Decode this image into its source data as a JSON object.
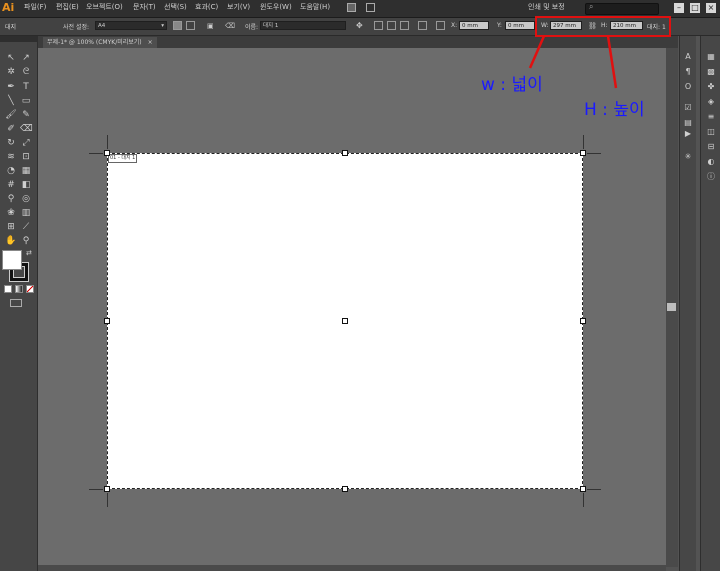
{
  "app": {
    "logo": "Ai"
  },
  "menu": [
    "파일(F)",
    "편집(E)",
    "오브젝트(O)",
    "문자(T)",
    "선택(S)",
    "효과(C)",
    "보기(V)",
    "윈도우(W)",
    "도움말(H)"
  ],
  "workspace": "인쇄 및 보정",
  "search_placeholder": "",
  "control": {
    "artboard_label": "대지",
    "preset_label": "사전 설정:",
    "preset_value": "A4",
    "name_label": "이름:",
    "name_value": "대지 1",
    "x_label": "X:",
    "x_value": "0 mm",
    "y_label": "Y:",
    "y_value": "0 mm",
    "w_label": "W:",
    "w_value": "297 mm",
    "h_label": "H:",
    "h_value": "210 mm",
    "artboard_count_label": "대지: 1"
  },
  "document_tab": {
    "title": "무제-1* @ 100% (CMYK/미리보기)",
    "close": "×"
  },
  "artboard": {
    "label": "01 - 대지 1"
  },
  "annotations": {
    "w": "w : 넓이",
    "h": "H : 높이"
  },
  "colors": {
    "annotation": "#1a1aff",
    "highlight": "#e01010"
  },
  "icons": [
    "selection-tool-icon",
    "direct-selection-tool-icon",
    "magic-wand-icon",
    "lasso-icon",
    "pen-tool-icon",
    "type-tool-icon",
    "line-tool-icon",
    "rectangle-tool-icon",
    "paintbrush-icon",
    "pencil-icon",
    "blob-brush-icon",
    "eraser-icon",
    "rotate-icon",
    "scale-icon",
    "width-tool-icon",
    "free-transform-icon",
    "shape-builder-icon",
    "perspective-icon",
    "mesh-icon",
    "gradient-icon",
    "eyedropper-icon",
    "blend-icon",
    "symbol-sprayer-icon",
    "graph-icon",
    "artboard-tool-icon",
    "slice-icon",
    "hand-icon",
    "zoom-icon"
  ]
}
